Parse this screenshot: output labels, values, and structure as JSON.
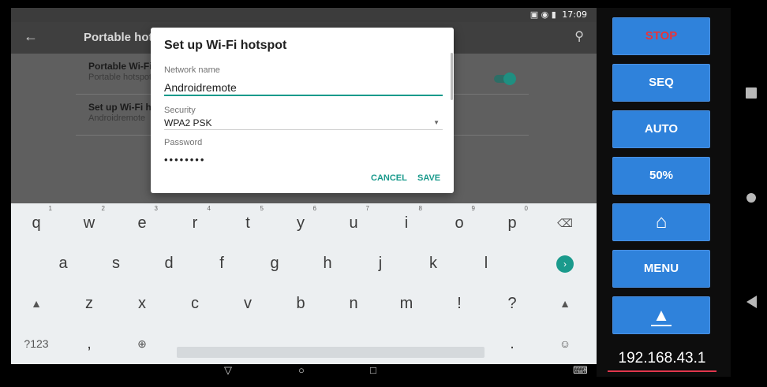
{
  "status_bar": {
    "icons": "▣ ◉ ▮",
    "time": "17:09"
  },
  "app_bar": {
    "title": "Portable hotspot"
  },
  "settings": {
    "items": [
      {
        "title": "Portable Wi-Fi hotspot",
        "subtitle": "Portable hotspot"
      },
      {
        "title": "Set up Wi-Fi hotspot",
        "subtitle": "Androidremote"
      }
    ],
    "toggle_on": true
  },
  "dialog": {
    "title": "Set up Wi-Fi hotspot",
    "network_label": "Network name",
    "network_value": "Androidremote",
    "security_label": "Security",
    "security_value": "WPA2 PSK",
    "password_label": "Password",
    "password_value": "••••••••",
    "cancel_label": "CANCEL",
    "save_label": "SAVE",
    "accent_color": "#1a9a8c"
  },
  "keyboard": {
    "row1": [
      {
        "k": "q",
        "h": "1"
      },
      {
        "k": "w",
        "h": "2"
      },
      {
        "k": "e",
        "h": "3"
      },
      {
        "k": "r",
        "h": "4"
      },
      {
        "k": "t",
        "h": "5"
      },
      {
        "k": "y",
        "h": "6"
      },
      {
        "k": "u",
        "h": "7"
      },
      {
        "k": "i",
        "h": "8"
      },
      {
        "k": "o",
        "h": "9"
      },
      {
        "k": "p",
        "h": "0"
      }
    ],
    "row2": [
      "a",
      "s",
      "d",
      "f",
      "g",
      "h",
      "j",
      "k",
      "l"
    ],
    "row3": [
      "z",
      "x",
      "c",
      "v",
      "b",
      "n",
      "m",
      "!",
      "?"
    ],
    "row4": {
      "symbols": "?123",
      "comma": ",",
      "globe": "⊕",
      "period": ".",
      "emoji": "☺"
    },
    "backspace_icon": "⌫",
    "shift_icon": "▲",
    "enter_icon": "›"
  },
  "nav_bar": {
    "back": "▽",
    "home": "○",
    "recent": "□",
    "keyboard": "⌨"
  },
  "remote": {
    "buttons": [
      {
        "label": "STOP",
        "color": "#e8343a"
      },
      {
        "label": "SEQ",
        "color": "#ffffff"
      },
      {
        "label": "AUTO",
        "color": "#ffffff"
      },
      {
        "label": "50%",
        "color": "#ffffff"
      },
      {
        "label": "⌂",
        "color": "#ffffff"
      },
      {
        "label": "MENU",
        "color": "#ffffff"
      },
      {
        "label": "▲",
        "color": "#ffffff"
      }
    ],
    "ip": "192.168.43.1",
    "button_color": "#2f82db"
  }
}
